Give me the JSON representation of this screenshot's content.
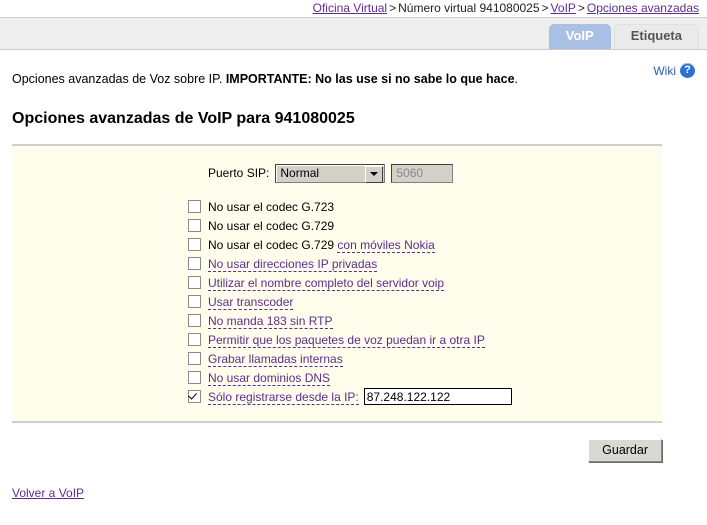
{
  "breadcrumb": {
    "items": [
      {
        "label": "Oficina Virtual",
        "link": true
      },
      {
        "label": "Número virtual 941080025",
        "link": false
      },
      {
        "label": "VoIP",
        "link": true
      },
      {
        "label": "Opciones avanzadas",
        "link": true
      }
    ],
    "separator": ">"
  },
  "tabs": [
    {
      "label": "VoIP",
      "active": true
    },
    {
      "label": "Etiqueta",
      "active": false
    }
  ],
  "wiki": {
    "label": "Wiki",
    "icon": "help-circle-icon",
    "icon_glyph": "?"
  },
  "intro": {
    "text": "Opciones avanzadas de Voz sobre IP.",
    "warning": "IMPORTANTE: No las use si no sabe lo que hace",
    "period": "."
  },
  "page_title": "Opciones avanzadas de VoIP para 941080025",
  "form": {
    "sip_port": {
      "label": "Puerto SIP:",
      "select_value": "Normal",
      "port_value": "5060",
      "port_disabled": true
    },
    "checkboxes": [
      {
        "prefix": "No usar el codec G.723",
        "tip": "",
        "checked": false
      },
      {
        "prefix": "No usar el codec G.729",
        "tip": "",
        "checked": false
      },
      {
        "prefix": "No usar el codec G.729 ",
        "tip": "con móviles Nokia",
        "checked": false
      },
      {
        "prefix": "",
        "tip": "No usar direcciones IP privadas",
        "checked": false
      },
      {
        "prefix": "",
        "tip": "Utilizar el nombre completo del servidor voip",
        "checked": false
      },
      {
        "prefix": "",
        "tip": "Usar transcoder",
        "checked": false
      },
      {
        "prefix": "",
        "tip": "No manda 183 sin RTP",
        "checked": false
      },
      {
        "prefix": "",
        "tip": "Permitir que los paquetes de voz puedan ir a otra IP",
        "checked": false
      },
      {
        "prefix": "",
        "tip": "Grabar llamadas internas",
        "checked": false
      },
      {
        "prefix": "",
        "tip": "No usar dominios DNS",
        "checked": false
      }
    ],
    "ip_restrict": {
      "label": "Sólo registrarse desde la IP:",
      "checked": true,
      "value": "87.248.122.122"
    },
    "save_label": "Guardar"
  },
  "footer": {
    "back_link": "Volver a VoIP"
  },
  "colors": {
    "active_tab": "#a9c0e4",
    "panel_bg": "#fffdeb",
    "link": "#5c2d91",
    "help_icon": "#2f6fd0"
  }
}
